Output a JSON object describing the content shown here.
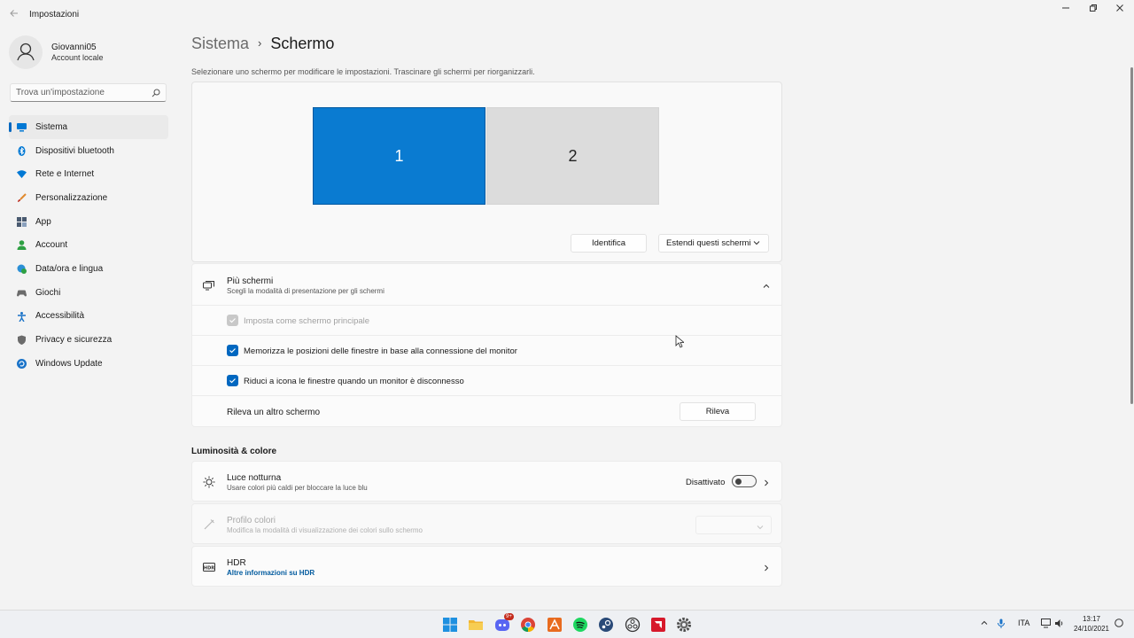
{
  "window": {
    "title": "Impostazioni"
  },
  "user": {
    "name": "Giovanni05",
    "account_type": "Account locale"
  },
  "search": {
    "placeholder": "Trova un'impostazione"
  },
  "sidebar": {
    "items": [
      {
        "label": "Sistema",
        "icon": "monitor-icon",
        "color": "#0078d4",
        "active": true
      },
      {
        "label": "Dispositivi bluetooth",
        "icon": "bluetooth-icon",
        "color": "#0078d4"
      },
      {
        "label": "Rete e Internet",
        "icon": "wifi-icon",
        "color": "#0078d4"
      },
      {
        "label": "Personalizzazione",
        "icon": "brush-icon",
        "color": "#e08a2e"
      },
      {
        "label": "App",
        "icon": "apps-icon",
        "color": "#4a5a70"
      },
      {
        "label": "Account",
        "icon": "person-icon",
        "color": "#2ea043"
      },
      {
        "label": "Data/ora e lingua",
        "icon": "globe-clock-icon",
        "color": "#2b8fd6"
      },
      {
        "label": "Giochi",
        "icon": "gamepad-icon",
        "color": "#6b6b6b"
      },
      {
        "label": "Accessibilità",
        "icon": "accessibility-icon",
        "color": "#1a73c8"
      },
      {
        "label": "Privacy e sicurezza",
        "icon": "shield-icon",
        "color": "#6b6b6b"
      },
      {
        "label": "Windows Update",
        "icon": "update-icon",
        "color": "#1a73c8"
      }
    ]
  },
  "breadcrumb": {
    "parent": "Sistema",
    "separator": "›",
    "current": "Schermo"
  },
  "display": {
    "instructions": "Selezionare uno schermo per modificare le impostazioni. Trascinare gli schermi per riorganizzarli.",
    "monitors": [
      {
        "label": "1",
        "selected": true
      },
      {
        "label": "2",
        "selected": false
      }
    ],
    "identify_label": "Identifica",
    "mode_value": "Estendi questi schermi"
  },
  "multiple_displays": {
    "title": "Più schermi",
    "subtitle": "Scegli la modalità di presentazione per gli schermi",
    "options": [
      {
        "label": "Imposta come schermo principale",
        "checked": true,
        "disabled": true
      },
      {
        "label": "Memorizza le posizioni delle finestre in base alla connessione del monitor",
        "checked": true,
        "disabled": false
      },
      {
        "label": "Riduci a icona le finestre quando un monitor è disconnesso",
        "checked": true,
        "disabled": false
      }
    ],
    "detect_text": "Rileva un altro schermo",
    "detect_button": "Rileva"
  },
  "brightness": {
    "section_title": "Luminosità & colore",
    "night_light": {
      "title": "Luce notturna",
      "subtitle": "Usare colori più caldi per bloccare la luce blu",
      "status": "Disattivato",
      "enabled": false
    },
    "color_profile": {
      "title": "Profilo colori",
      "subtitle": "Modifica la modalità di visualizzazione dei colori sullo schermo"
    },
    "hdr": {
      "title": "HDR",
      "link": "Altre informazioni su HDR"
    }
  },
  "taskbar": {
    "apps": [
      "start-icon",
      "file-explorer-icon",
      "discord-icon",
      "chrome-icon",
      "app-orange-icon",
      "spotify-icon",
      "steam-icon",
      "obs-icon",
      "amd-icon",
      "settings-icon"
    ],
    "discord_badge": "9+",
    "language": "ITA",
    "time": "13:17",
    "date": "24/10/2021"
  }
}
